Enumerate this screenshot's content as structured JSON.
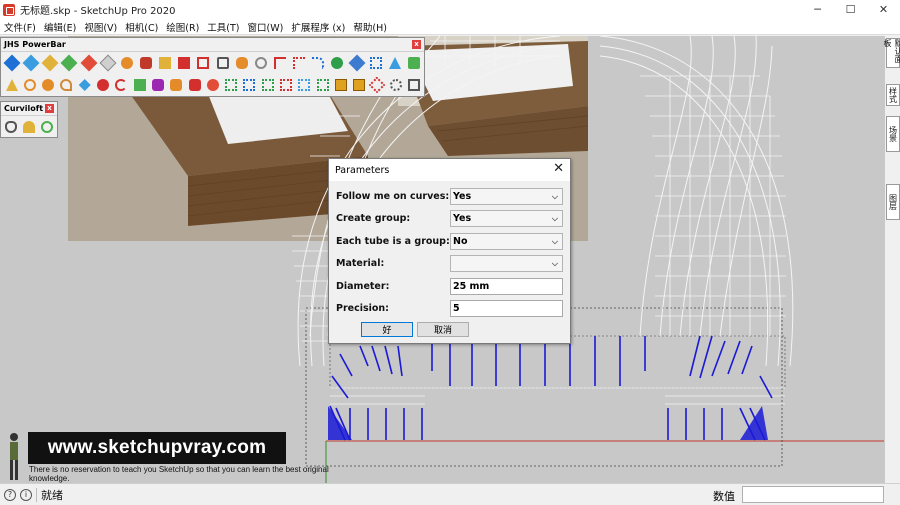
{
  "window": {
    "title": "无标题.skp - SketchUp Pro 2020",
    "controls": {
      "minimize": "─",
      "maximize": "☐",
      "close": "✕"
    }
  },
  "menu": [
    "文件(F)",
    "编辑(E)",
    "视图(V)",
    "相机(C)",
    "绘图(R)",
    "工具(T)",
    "窗口(W)",
    "扩展程序 (x)",
    "帮助(H)"
  ],
  "toolbars": {
    "powerbar": {
      "title": "JHS PowerBar",
      "close": "x"
    },
    "curviloft": {
      "title": "Curviloft",
      "close": "x"
    }
  },
  "right_dock": {
    "tabs": [
      "默认面板",
      "样式",
      "场景",
      "图层"
    ]
  },
  "dialog": {
    "title": "Parameters",
    "close": "✕",
    "rows": [
      {
        "label": "Follow me on curves:",
        "value": "Yes",
        "type": "select"
      },
      {
        "label": "Create group:",
        "value": "Yes",
        "type": "select"
      },
      {
        "label": "Each tube is a group:",
        "value": "No",
        "type": "select"
      },
      {
        "label": "Material:",
        "value": "",
        "type": "select"
      },
      {
        "label": "Diameter:",
        "value": "25 mm",
        "type": "text"
      },
      {
        "label": "Precision:",
        "value": "5",
        "type": "text"
      }
    ],
    "ok": "好",
    "cancel": "取消"
  },
  "watermark": {
    "url": "www.sketchupvray.com",
    "caption": "There is no reservation to teach you SketchUp so that you can learn the best original knowledge."
  },
  "status": {
    "ready": "就绪",
    "value_label": "数值",
    "value": ""
  },
  "colors": {
    "accent": "#0078d7",
    "close_red": "#e03e3e",
    "blue_lines": "#1a1ad6",
    "red_axis": "#c0392b"
  }
}
